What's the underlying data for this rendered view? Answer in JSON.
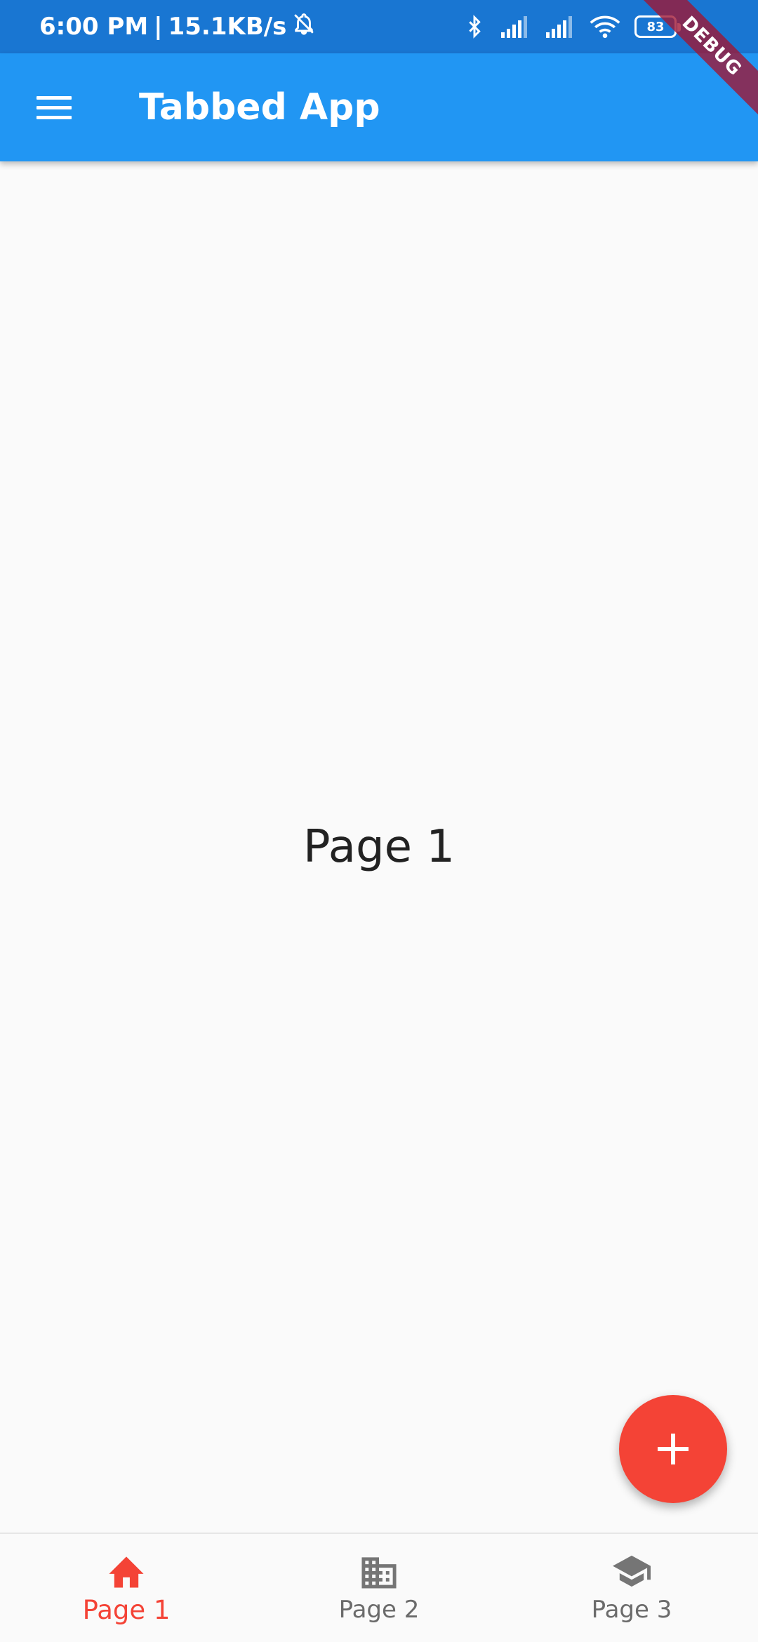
{
  "status_bar": {
    "time": "6:00 PM",
    "separator": "|",
    "network_speed": "15.1KB/s",
    "battery_level": "83",
    "icons": [
      "bell-off-icon",
      "bluetooth-icon",
      "signal-icon",
      "signal-icon",
      "wifi-icon",
      "battery-icon"
    ]
  },
  "debug_banner": {
    "label": "DEBUG"
  },
  "app_bar": {
    "title": "Tabbed App",
    "menu_icon": "menu-icon",
    "background": "#2196f3"
  },
  "main": {
    "page_label": "Page 1"
  },
  "fab": {
    "icon": "plus-icon",
    "color": "#f44336"
  },
  "bottom_nav": {
    "active_color": "#f44336",
    "inactive_color": "#6b6b6b",
    "items": [
      {
        "label": "Page 1",
        "icon": "home-icon",
        "active": true
      },
      {
        "label": "Page 2",
        "icon": "building-icon",
        "active": false
      },
      {
        "label": "Page 3",
        "icon": "school-icon",
        "active": false
      }
    ]
  }
}
